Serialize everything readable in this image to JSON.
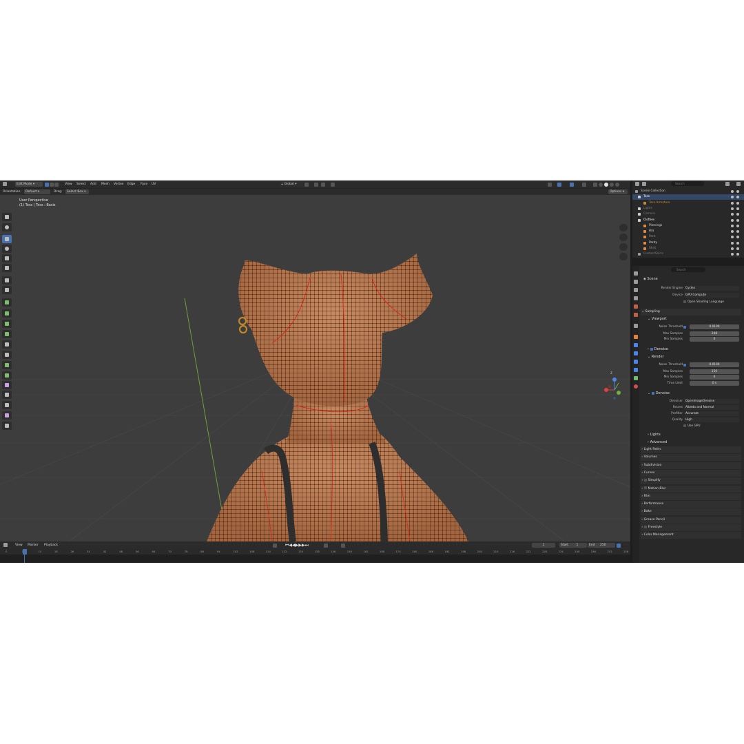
{
  "header": {
    "mode": "Edit Mode",
    "menus": [
      "View",
      "Select",
      "Add",
      "Mesh",
      "Vertex",
      "Edge",
      "Face",
      "UV"
    ],
    "transform_orientation": "Global",
    "tool_settings": {
      "orientation_label": "Orientation:",
      "orientation_value": "Default",
      "drag_label": "Drag:",
      "drag_value": "Select Box",
      "options": "Options"
    }
  },
  "viewport": {
    "view_name": "User Perspective",
    "object_info": "(1) Tess | Tess : Basis",
    "colors": {
      "background": "#3d3d3d",
      "skin": "#c08058",
      "seam": "#d42a1a",
      "y_axis": "#6f9f3c"
    },
    "toolbar_icons": [
      "select-box-icon",
      "cursor-icon",
      "move-icon",
      "rotate-icon",
      "scale-icon",
      "transform-icon",
      "annotate-icon",
      "measure-icon",
      "add-cube-icon",
      "extrude-icon",
      "inset-icon",
      "bevel-icon",
      "loop-cut-icon",
      "knife-icon",
      "poly-build-icon",
      "spin-icon",
      "smooth-icon",
      "edge-slide-icon",
      "shrink-fatten-icon",
      "shear-icon",
      "rip-icon"
    ],
    "nav_gizmo_axes": [
      "X",
      "Y",
      "Z"
    ]
  },
  "timeline": {
    "menus": [
      "View",
      "Marker",
      "Playback"
    ],
    "current_frame": "1",
    "start_label": "Start",
    "start_value": "1",
    "end_label": "End",
    "end_value": "250",
    "ruler": [
      "0",
      "1",
      "10",
      "18",
      "26",
      "34",
      "42",
      "48",
      "56",
      "64",
      "70",
      "78",
      "86",
      "94",
      "102",
      "108",
      "114",
      "122",
      "130",
      "138",
      "146",
      "156",
      "162",
      "168",
      "174",
      "180",
      "186",
      "192",
      "198",
      "204",
      "210",
      "216",
      "222",
      "228",
      "234",
      "240",
      "246",
      "252",
      "258"
    ]
  },
  "outliner": {
    "search_placeholder": "Search",
    "items": [
      {
        "label": "Scene Collection",
        "color": "#cfcfcf"
      },
      {
        "label": "Tess",
        "color": "#ffffff"
      },
      {
        "label": "Tess.Armature",
        "color": "#c88a38"
      },
      {
        "label": "Lights",
        "color": "#7a7a7a"
      },
      {
        "label": "Camera",
        "color": "#7a7a7a"
      },
      {
        "label": "Clothes",
        "color": "#ffffff"
      },
      {
        "label": "Piercings",
        "color": "#dcdcdc"
      },
      {
        "label": "Bra",
        "color": "#dcdcdc"
      },
      {
        "label": "Pant",
        "color": "#8a8a8a"
      },
      {
        "label": "Panty",
        "color": "#dcdcdc"
      },
      {
        "label": "Shirt",
        "color": "#8a8a8a"
      },
      {
        "label": "ContactShirts",
        "color": "#7a7a7a"
      }
    ]
  },
  "properties": {
    "search_placeholder": "Search",
    "context": "Scene",
    "render_engine_label": "Render Engine",
    "render_engine": "Cycles",
    "device_label": "Device",
    "device": "GPU Compute",
    "osl_label": "Open Shading Language",
    "sampling": {
      "title": "Sampling",
      "viewport_title": "Viewport",
      "viewport": [
        {
          "label": "Noise Threshold",
          "value": "0.0100"
        },
        {
          "label": "Max Samples",
          "value": "248"
        },
        {
          "label": "Min Samples",
          "value": "0"
        }
      ],
      "denoise_label": "Denoise",
      "render_title": "Render",
      "render": [
        {
          "label": "Noise Threshold",
          "value": "0.0100"
        },
        {
          "label": "Max Samples",
          "value": "150"
        },
        {
          "label": "Min Samples",
          "value": "0"
        },
        {
          "label": "Time Limit",
          "value": "0 s"
        }
      ],
      "render_denoise_label": "Denoise",
      "denoiser": [
        {
          "label": "Denoiser",
          "value": "OpenImageDenoise"
        },
        {
          "label": "Passes",
          "value": "Albedo and Normal"
        },
        {
          "label": "Prefilter",
          "value": "Accurate"
        },
        {
          "label": "Quality",
          "value": "High"
        }
      ],
      "use_gpu": "Use GPU",
      "lights": "Lights",
      "advanced": "Advanced"
    },
    "panels": [
      "Light Paths",
      "Volumes",
      "Subdivision",
      "Curves",
      "Simplify",
      "Motion Blur",
      "Film",
      "Performance",
      "Bake",
      "Grease Pencil",
      "Freestyle",
      "Color Management"
    ]
  }
}
